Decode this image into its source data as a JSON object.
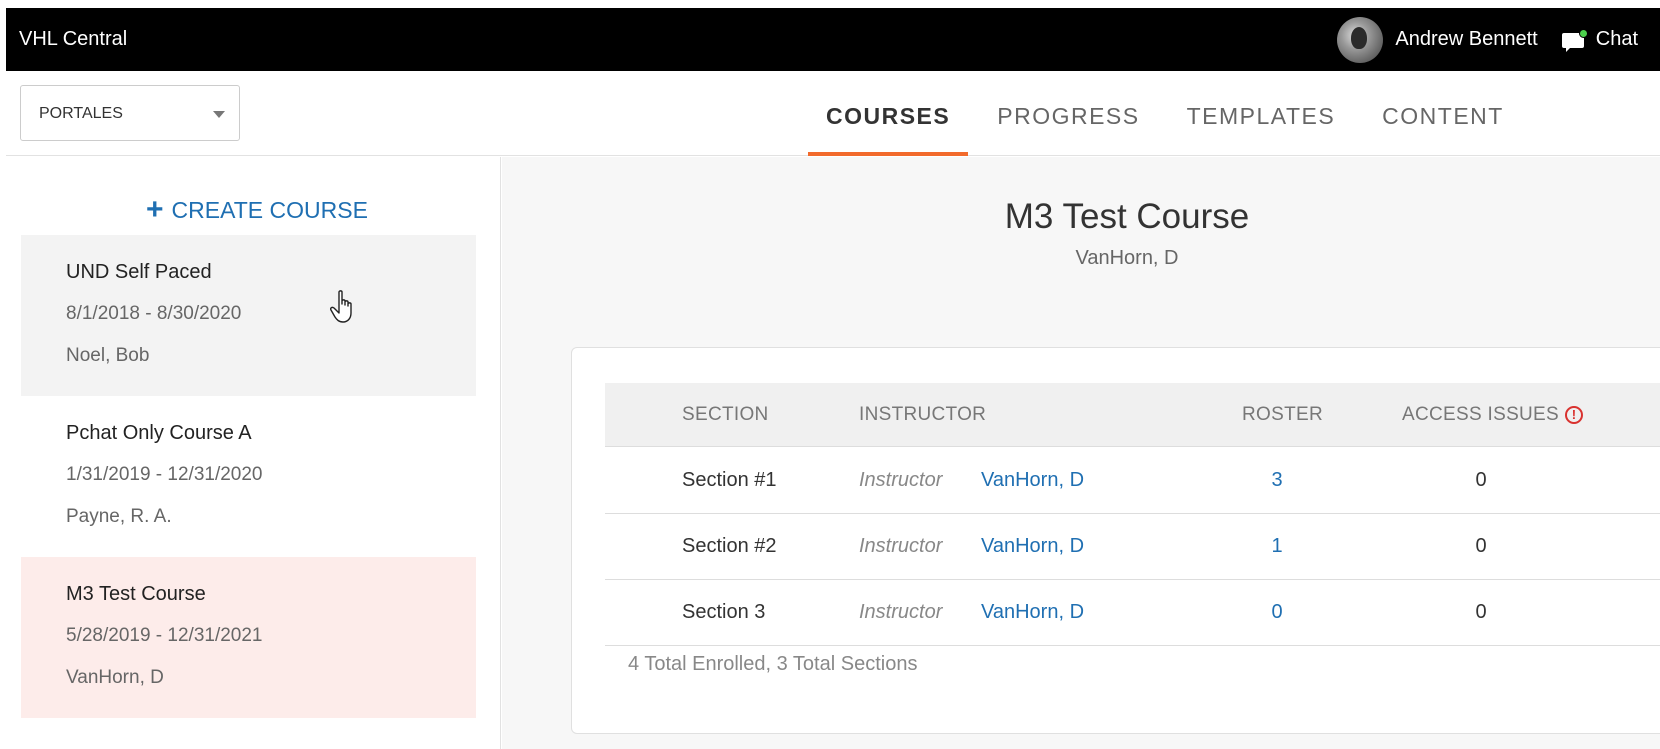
{
  "app": {
    "title": "VHL Central"
  },
  "user": {
    "name": "Andrew Bennett",
    "avatar_icon": "user-avatar-icon"
  },
  "chat": {
    "label": "Chat",
    "icon": "chat-bubble-icon",
    "status_color": "#4cd04c"
  },
  "selector": {
    "value": "PORTALES"
  },
  "tabs": [
    {
      "label": "COURSES",
      "active": true
    },
    {
      "label": "PROGRESS",
      "active": false
    },
    {
      "label": "TEMPLATES",
      "active": false
    },
    {
      "label": "CONTENT",
      "active": false
    }
  ],
  "sidebar": {
    "create_label": "CREATE COURSE",
    "courses": [
      {
        "name": "UND Self Paced",
        "dates": "8/1/2018 - 8/30/2020",
        "instructor": "Noel, Bob"
      },
      {
        "name": "Pchat Only Course A",
        "dates": "1/31/2019 - 12/31/2020",
        "instructor": "Payne, R. A."
      },
      {
        "name": "M3 Test Course",
        "dates": "5/28/2019 - 12/31/2021",
        "instructor": "VanHorn, D"
      }
    ]
  },
  "main": {
    "title": "M3 Test Course",
    "subtitle": "VanHorn, D",
    "headers": {
      "section": "SECTION",
      "instructor": "INSTRUCTOR",
      "roster": "ROSTER",
      "access": "ACCESS ISSUES"
    },
    "rows": [
      {
        "section": "Section #1",
        "role": "Instructor",
        "instructor": "VanHorn, D",
        "roster": "3",
        "access": "0"
      },
      {
        "section": "Section #2",
        "role": "Instructor",
        "instructor": "VanHorn, D",
        "roster": "1",
        "access": "0"
      },
      {
        "section": "Section 3",
        "role": "Instructor",
        "instructor": "VanHorn, D",
        "roster": "0",
        "access": "0"
      }
    ],
    "footer": "4 Total Enrolled, 3 Total Sections"
  },
  "colors": {
    "accent": "#f26a2c",
    "link": "#1f6fb2",
    "selected_bg": "#fdecea",
    "warning": "#d9322f"
  }
}
